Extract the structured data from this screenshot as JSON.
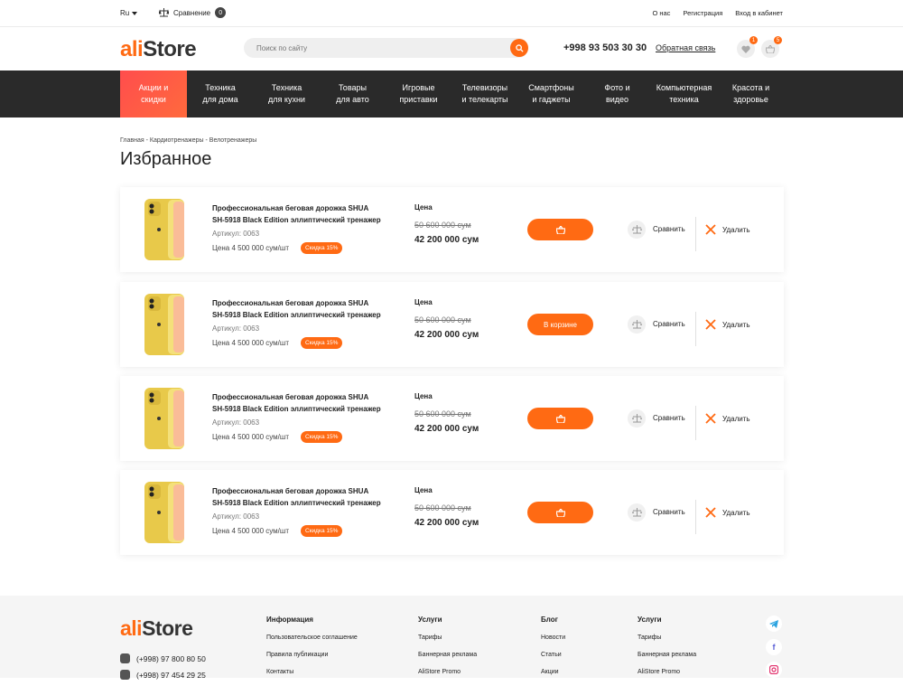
{
  "topbar": {
    "lang": "Ru",
    "compare_label": "Сравнение",
    "compare_count": "0",
    "links": [
      "О нас",
      "Регистрация",
      "Вход в кабинет"
    ]
  },
  "header": {
    "logo_a": "ali",
    "logo_b": "Store",
    "search_placeholder": "Поиск по сайту",
    "phone": "+998 93 503 30 30",
    "callback": "Обратная связь",
    "fav_count": "1",
    "cart_count": "5"
  },
  "nav": [
    {
      "line1": "Акции и",
      "line2": "скидки"
    },
    {
      "line1": "Техника",
      "line2": "для дома"
    },
    {
      "line1": "Техника",
      "line2": "для кухни"
    },
    {
      "line1": "Товары",
      "line2": "для авто"
    },
    {
      "line1": "Игровые",
      "line2": "приставки"
    },
    {
      "line1": "Телевизоры",
      "line2": "и телекарты"
    },
    {
      "line1": "Смартфоны",
      "line2": "и гаджеты"
    },
    {
      "line1": "Фото и",
      "line2": "видео"
    },
    {
      "line1": "Компьютерная",
      "line2": "техника"
    },
    {
      "line1": "Красота и",
      "line2": "здоровье"
    }
  ],
  "breadcrumb": "Главная - Кардиотренажеры - Велотренажеры",
  "page_title": "Избранное",
  "products": [
    {
      "title_1": "Профессиональная беговая дорожка SHUA",
      "title_2": "SH-5918 Black Edition эллиптический тренажер",
      "article": "Артикул: 0063",
      "unit_price": "Цена 4 500 000 сум/шт",
      "discount": "Скидка 15%",
      "price_label": "Цена",
      "old_price": "50 600 000 сум",
      "new_price": "42 200 000 сум",
      "cart_label": "",
      "compare": "Сравнить",
      "delete": "Удалить"
    },
    {
      "title_1": "Профессиональная беговая дорожка SHUA",
      "title_2": "SH-5918 Black Edition эллиптический тренажер",
      "article": "Артикул: 0063",
      "unit_price": "Цена 4 500 000 сум/шт",
      "discount": "Скидка 15%",
      "price_label": "Цена",
      "old_price": "50 600 000 сум",
      "new_price": "42 200 000 сум",
      "cart_label": "В корзине",
      "compare": "Сравнить",
      "delete": "Удалить"
    },
    {
      "title_1": "Профессиональная беговая дорожка SHUA",
      "title_2": "SH-5918 Black Edition эллиптический тренажер",
      "article": "Артикул: 0063",
      "unit_price": "Цена 4 500 000 сум/шт",
      "discount": "Скидка 15%",
      "price_label": "Цена",
      "old_price": "50 600 000 сум",
      "new_price": "42 200 000 сум",
      "cart_label": "",
      "compare": "Сравнить",
      "delete": "Удалить"
    },
    {
      "title_1": "Профессиональная беговая дорожка SHUA",
      "title_2": "SH-5918 Black Edition эллиптический тренажер",
      "article": "Артикул: 0063",
      "unit_price": "Цена 4 500 000 сум/шт",
      "discount": "Скидка 15%",
      "price_label": "Цена",
      "old_price": "50 600 000 сум",
      "new_price": "42 200 000 сум",
      "cart_label": "",
      "compare": "Сравнить",
      "delete": "Удалить"
    }
  ],
  "footer": {
    "logo_a": "ali",
    "logo_b": "Store",
    "phones": [
      "(+998) 97 800 80 50",
      "(+998) 97 454 29 25"
    ],
    "columns": [
      {
        "heading": "Информация",
        "links": [
          "Пользовательское соглашение",
          "Правила публикации",
          "Контакты"
        ]
      },
      {
        "heading": "Услуги",
        "links": [
          "Тарифы",
          "Баннерная реклама",
          "AliStore Promo"
        ]
      },
      {
        "heading": "Блог",
        "links": [
          "Новости",
          "Статьи",
          "Акции"
        ]
      },
      {
        "heading": "Услуги",
        "links": [
          "Тарифы",
          "Баннерная реклама",
          "AliStore Promo"
        ]
      }
    ],
    "social": [
      "telegram-icon",
      "facebook-icon",
      "instagram-icon"
    ]
  },
  "colors": {
    "accent": "#ff6a13",
    "nav_bg": "#2a2a2a",
    "nav_active": "#ff5a45"
  }
}
